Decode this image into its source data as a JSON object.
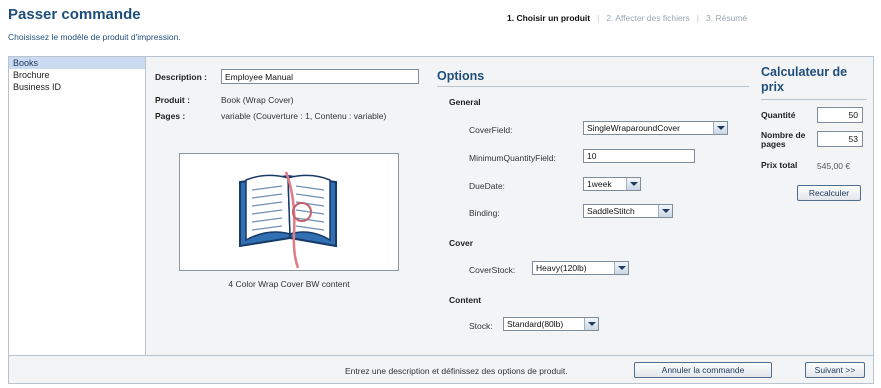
{
  "header": {
    "title": "Passer commande",
    "subtitle": "Choisissez le modèle de produit d'impression."
  },
  "steps": {
    "step1": "1. Choisir un produit",
    "step2": "2. Affecter des fichiers",
    "step3": "3. Résumé",
    "separator": "|"
  },
  "product_list": [
    "Books",
    "Brochure",
    "Business ID"
  ],
  "details": {
    "description_label": "Description :",
    "description_value": "Employee Manual",
    "product_label": "Produit :",
    "product_value": "Book (Wrap Cover)",
    "pages_label": "Pages :",
    "pages_value": "variable (Couverture : 1, Contenu : variable)",
    "image_caption": "4 Color Wrap Cover BW content",
    "image_icon": "book-icon"
  },
  "options": {
    "title": "Options",
    "general": {
      "title": "General",
      "cover_field_label": "CoverField:",
      "cover_field_value": "SingleWraparoundCover",
      "min_qty_label": "MinimumQuantityField:",
      "min_qty_value": "10",
      "due_date_label": "DueDate:",
      "due_date_value": "1week",
      "binding_label": "Binding:",
      "binding_value": "SaddleStitch"
    },
    "cover": {
      "title": "Cover",
      "cover_stock_label": "CoverStock:",
      "cover_stock_value": "Heavy(120lb)"
    },
    "content": {
      "title": "Content",
      "stock_label": "Stock:",
      "stock_value": "Standard(80lb)"
    }
  },
  "price": {
    "title": "Calculateur de prix",
    "quantity_label": "Quantité",
    "quantity_value": "50",
    "pages_label": "Nombre de pages",
    "pages_value": "53",
    "total_label": "Prix total",
    "total_value": "545,00 €",
    "recalc_label": "Recalculer"
  },
  "footer": {
    "message": "Entrez une description et définissez des options de produit.",
    "cancel_label": "Annuler la commande",
    "next_label": "Suivant >>"
  },
  "colors": {
    "accent": "#1f4e79",
    "selected": "#c9daf1"
  }
}
